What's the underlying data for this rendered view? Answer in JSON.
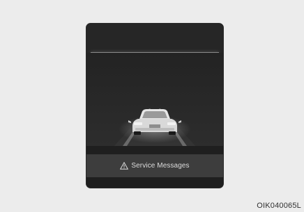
{
  "cluster": {
    "message": "Service Messages",
    "warning_icon": "warning-triangle-icon",
    "vehicle_icon": "car-rear-icon"
  },
  "figure_code": "OIK040065L",
  "colors": {
    "background": "#ececec",
    "display": "#1f1f1f",
    "message_bar": "#3d3d3d",
    "text": "#dcdcdc"
  }
}
